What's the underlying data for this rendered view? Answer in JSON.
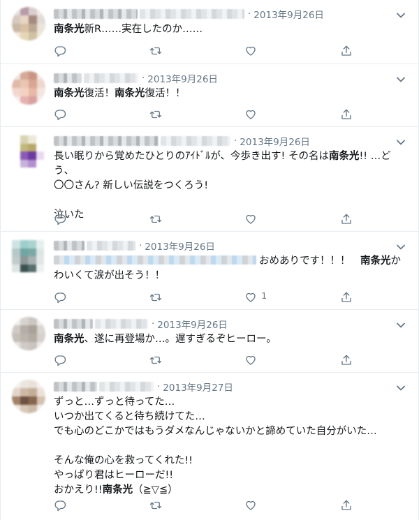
{
  "tweets": [
    {
      "date": "2013年9月26日",
      "kw": "南条光",
      "rest": "新R……実在したのか……",
      "likes": ""
    },
    {
      "date": "2013年9月26日",
      "kw": "南条光",
      "mid": "復活！",
      "kw2": "南条光",
      "rest": "復活！！",
      "likes": ""
    },
    {
      "date": "2013年9月26日",
      "pre": "長い眠りから覚めたひとりのｱｲﾄﾞﾙが、今歩き出す! その名は",
      "kw": "南条光",
      "rest": "!! …どう、\n〇〇さん? 新しい伝説をつくろう!\n\n泣いた",
      "likes": ""
    },
    {
      "date": "2013年9月26日",
      "pre": "おめありです！！！　",
      "kw": "南条光",
      "rest": "かわいくて涙が出そう！！",
      "likes": "1"
    },
    {
      "date": "2013年9月26日",
      "kw": "南条光",
      "rest": "、遂に再登場か…。遅すぎるぞヒーロー。",
      "likes": ""
    },
    {
      "date": "2013年9月27日",
      "pre": "ずっと…ずっと待ってた…\nいつか出てくると待ち続けてた…\nでも心のどこかではもうダメなんじゃないかと諦めていた自分がいた…\n\nそんな俺の心を救ってくれた!!\nやっぱり君はヒーローだ!!\nおかえり!!",
      "kw": "南条光",
      "rest": "（≧▽≦）",
      "likes": ""
    }
  ],
  "icons": {
    "reply": "reply-icon",
    "retweet": "retweet-icon",
    "like": "heart-icon",
    "share": "share-icon",
    "menu": "chevron-down-icon"
  }
}
